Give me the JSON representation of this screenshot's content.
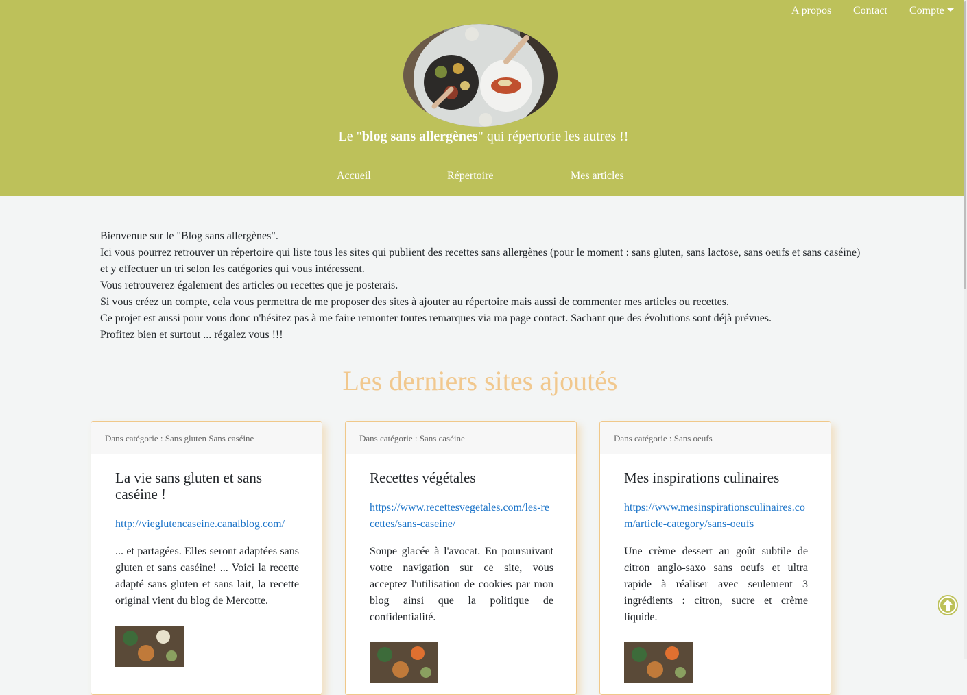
{
  "topnav": {
    "about": "A propos",
    "contact": "Contact",
    "account": "Compte"
  },
  "tagline": {
    "before": "Le \"",
    "bold": "blog sans allergènes",
    "after": "\" qui répertorie les autres !!"
  },
  "mainnav": {
    "home": "Accueil",
    "directory": "Répertoire",
    "articles": "Mes articles"
  },
  "intro": {
    "lines": [
      "Bienvenue sur le \"Blog sans allergènes\".",
      "Ici vous pourrez retrouver un répertoire qui liste tous les sites qui publient des recettes sans allergènes (pour le moment : sans gluten, sans lactose, sans oeufs et sans caséine)",
      "et y effectuer un tri selon les catégories qui vous intéressent.",
      "Vous retrouverez également des articles ou recettes que je posterais.",
      "Si vous créez un compte, cela vous permettra de me proposer des sites à ajouter au répertoire mais aussi de commenter mes articles ou recettes.",
      "Ce projet est aussi pour vous donc n'hésitez pas à me faire remonter toutes remarques via ma page contact. Sachant que des évolutions sont déjà prévues.",
      "Profitez bien et surtout ... régalez vous !!!"
    ]
  },
  "section_title": "Les derniers sites ajoutés",
  "cards": [
    {
      "category": "Dans catégorie : Sans gluten Sans caséine",
      "title": "La vie sans gluten et sans caséine !",
      "link": "http://vieglutencaseine.canalblog.com/",
      "text": "... et partagées. Elles seront adaptées sans gluten et sans caséine! ... Voici la recette adapté sans gluten et sans lait, la recette original vient du blog de Mercotte."
    },
    {
      "category": "Dans catégorie : Sans caséine",
      "title": "Recettes végétales",
      "link": "https://www.recettesvegetales.com/les-recettes/sans-caseine/",
      "text": "Soupe glacée à l'avocat. En poursuivant votre navigation sur ce site, vous acceptez l'utilisation de cookies par mon blog ainsi que la politique de confidentialité."
    },
    {
      "category": "Dans catégorie : Sans oeufs",
      "title": "Mes inspirations culinaires",
      "link": "https://www.mesinspirationsculinaires.com/article-category/sans-oeufs",
      "text": "Une crème dessert au goût subtile de citron anglo-saxo sans oeufs et ultra rapide à réaliser avec seulement 3 ingrédients : citron, sucre et crème liquide."
    }
  ],
  "colors": {
    "header_bg": "#bdc15a",
    "page_bg": "#f3f5f5",
    "section_title": "#f1c88e",
    "link": "#1a73c8",
    "card_border": "#f0c88a"
  },
  "icons": {
    "scroll_top": "arrow-up-circle-icon",
    "dropdown": "caret-down-icon"
  }
}
